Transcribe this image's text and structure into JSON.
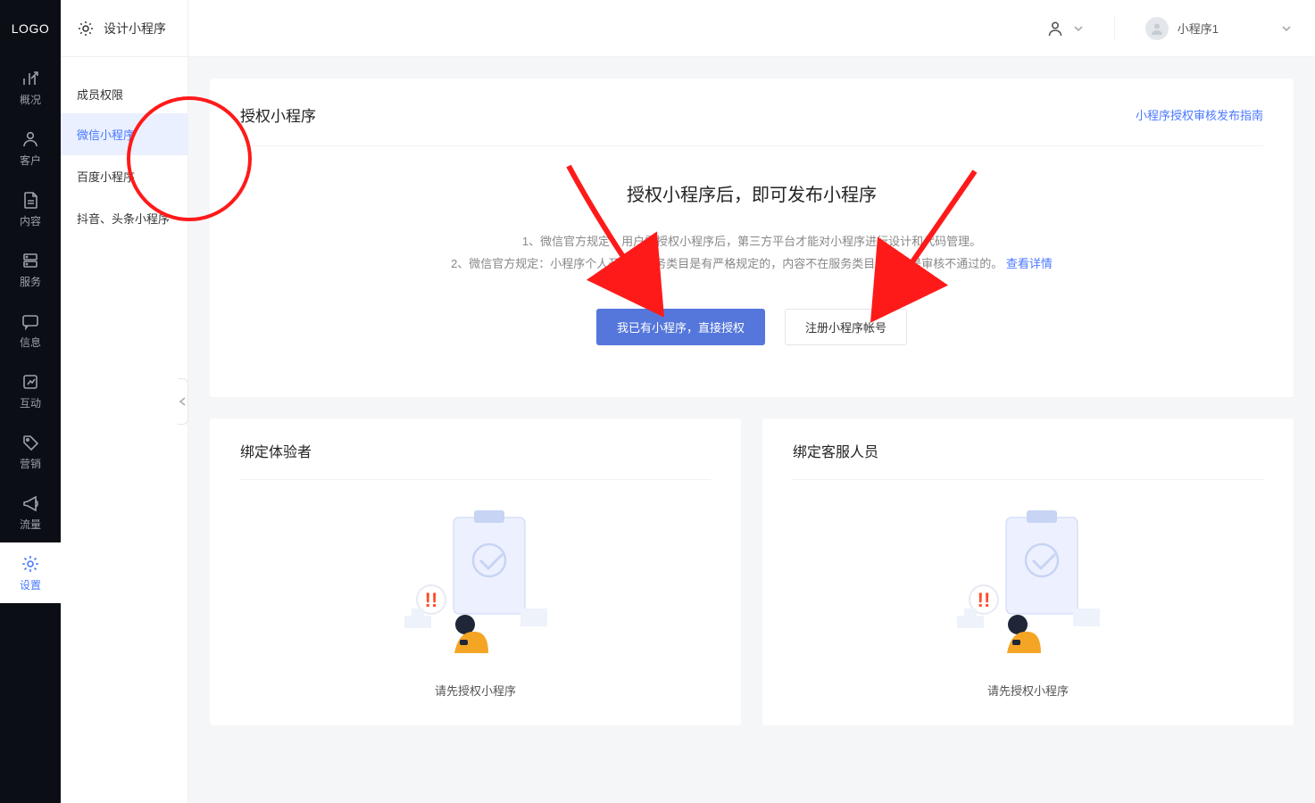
{
  "logo": "LOGO",
  "primary_nav": {
    "items": [
      {
        "label": "概况",
        "icon": "overview"
      },
      {
        "label": "客户",
        "icon": "person"
      },
      {
        "label": "内容",
        "icon": "doc"
      },
      {
        "label": "服务",
        "icon": "stack"
      },
      {
        "label": "信息",
        "icon": "message"
      },
      {
        "label": "互动",
        "icon": "frame"
      },
      {
        "label": "营销",
        "icon": "tag"
      },
      {
        "label": "流量",
        "icon": "horn"
      },
      {
        "label": "设置",
        "icon": "gear",
        "active": true
      }
    ]
  },
  "sub_nav": {
    "top_label": "设计小程序",
    "section_title": "成员权限",
    "items": [
      {
        "label": "微信小程序",
        "active": true
      },
      {
        "label": "百度小程序"
      },
      {
        "label": "抖音、头条小程序"
      }
    ]
  },
  "header": {
    "site_label": "小程序1"
  },
  "auth_panel": {
    "title": "授权小程序",
    "help_link": "小程序授权审核发布指南",
    "hero_title": "授权小程序后，即可发布小程序",
    "line1": "1、微信官方规定：用户需授权小程序后，第三方平台才能对小程序进行设计和代码管理。",
    "line2_prefix": "2、微信官方规定：小程序个人开放的服务类目是有严格规定的，内容不在服务类目中的，是审核不通过的。",
    "line2_link": "查看详情",
    "btn_primary": "我已有小程序，直接授权",
    "btn_outline": "注册小程序帐号"
  },
  "card_tester": {
    "title": "绑定体验者",
    "empty": "请先授权小程序"
  },
  "card_support": {
    "title": "绑定客服人员",
    "empty": "请先授权小程序"
  },
  "colors": {
    "accent": "#4a78ff",
    "annot": "#ff1a1a"
  }
}
